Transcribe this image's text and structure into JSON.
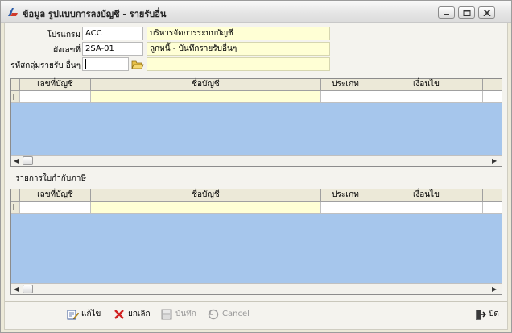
{
  "window": {
    "title": "ข้อมูล รูปแบบการลงบัญชี - รายรับอื่น"
  },
  "form": {
    "program_label": "โปรแกรม",
    "program_code": "ACC",
    "program_name": "บริหารจัดการระบบบัญชี",
    "docgroup_label": "ผังเลขที่",
    "docgroup_code": "2SA-01",
    "docgroup_name": "ลูกหนี้ - บันทึกรายรับอื่นๆ",
    "income_group_label": "รหัสกลุ่มรายรับ อื่นๆ",
    "income_group_code": "",
    "income_group_name": ""
  },
  "grid1": {
    "columns": [
      "เลขที่บัญชี",
      "ชื่อบัญชี",
      "ประเภท",
      "เงื่อนไข"
    ]
  },
  "section2_label": "รายการใบกำกับภาษี",
  "grid2": {
    "columns": [
      "เลขที่บัญชี",
      "ชื่อบัญชี",
      "ประเภท",
      "เงื่อนไข"
    ]
  },
  "toolbar": {
    "edit": "แก้ไข",
    "cancel_th": "ยกเลิก",
    "save": "บันทึก",
    "cancel_en": "Cancel",
    "close": "ปิด"
  },
  "colors": {
    "grid_bg": "#a6c6ec",
    "readonly_bg": "#ffffd5",
    "window_bg": "#ece9d8"
  }
}
